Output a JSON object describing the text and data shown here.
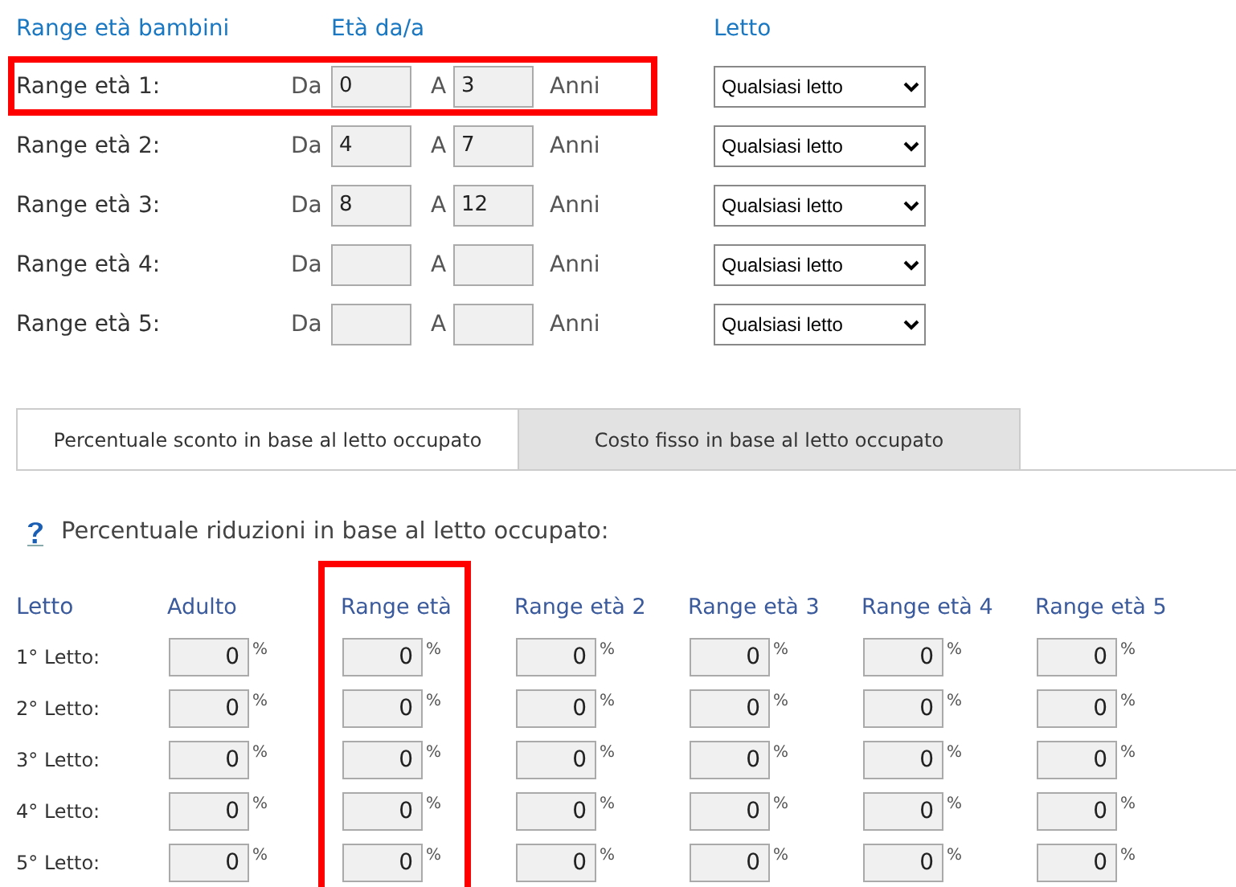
{
  "range_header": {
    "label": "Range età bambini",
    "ages": "Età da/a",
    "bed": "Letto"
  },
  "range_rows": [
    {
      "label": "Range età 1:",
      "from_label": "Da",
      "from": "0",
      "to_label": "A",
      "to": "3",
      "unit": "Anni",
      "bed": "Qualsiasi letto",
      "highlighted": true
    },
    {
      "label": "Range età 2:",
      "from_label": "Da",
      "from": "4",
      "to_label": "A",
      "to": "7",
      "unit": "Anni",
      "bed": "Qualsiasi letto",
      "highlighted": false
    },
    {
      "label": "Range età 3:",
      "from_label": "Da",
      "from": "8",
      "to_label": "A",
      "to": "12",
      "unit": "Anni",
      "bed": "Qualsiasi letto",
      "highlighted": false
    },
    {
      "label": "Range età 4:",
      "from_label": "Da",
      "to_label": "A",
      "unit": "Anni",
      "bed": "Qualsiasi letto",
      "highlighted": false
    },
    {
      "label": "Range età 5:",
      "from_label": "Da",
      "to_label": "A",
      "unit": "Anni",
      "bed": "Qualsiasi letto",
      "highlighted": false
    }
  ],
  "tabs": [
    {
      "label": "Percentuale sconto in base al letto occupato",
      "selected": true
    },
    {
      "label": "Costo fisso in base al letto occupato",
      "selected": false
    }
  ],
  "section_title": "Percentuale riduzioni in base al letto occupato:",
  "reductions": {
    "label_header": "Letto",
    "row_labels": [
      "1° Letto:",
      "2° Letto:",
      "3° Letto:",
      "4° Letto:",
      "5° Letto:"
    ],
    "columns": [
      {
        "header": "Adulto",
        "highlighted": false,
        "cells": [
          {
            "value": "0",
            "unit": "%"
          },
          {
            "value": "0",
            "unit": "%"
          },
          {
            "value": "0",
            "unit": "%"
          },
          {
            "value": "0",
            "unit": "%"
          },
          {
            "value": "0",
            "unit": "%"
          }
        ]
      },
      {
        "header": "Range età",
        "highlighted": true,
        "cells": [
          {
            "value": "0",
            "unit": "%"
          },
          {
            "value": "0",
            "unit": "%"
          },
          {
            "value": "0",
            "unit": "%"
          },
          {
            "value": "0",
            "unit": "%"
          },
          {
            "value": "0",
            "unit": "%"
          }
        ]
      },
      {
        "header": "Range età 2",
        "highlighted": false,
        "cells": [
          {
            "value": "0",
            "unit": "%"
          },
          {
            "value": "0",
            "unit": "%"
          },
          {
            "value": "0",
            "unit": "%"
          },
          {
            "value": "0",
            "unit": "%"
          },
          {
            "value": "0",
            "unit": "%"
          }
        ]
      },
      {
        "header": "Range età 3",
        "highlighted": false,
        "cells": [
          {
            "value": "0",
            "unit": "%"
          },
          {
            "value": "0",
            "unit": "%"
          },
          {
            "value": "0",
            "unit": "%"
          },
          {
            "value": "0",
            "unit": "%"
          },
          {
            "value": "0",
            "unit": "%"
          }
        ]
      },
      {
        "header": "Range età 4",
        "highlighted": false,
        "cells": [
          {
            "value": "0",
            "unit": "%"
          },
          {
            "value": "0",
            "unit": "%"
          },
          {
            "value": "0",
            "unit": "%"
          },
          {
            "value": "0",
            "unit": "%"
          },
          {
            "value": "0",
            "unit": "%"
          }
        ]
      },
      {
        "header": "Range età 5",
        "highlighted": false,
        "cells": [
          {
            "value": "0",
            "unit": "%"
          },
          {
            "value": "0",
            "unit": "%"
          },
          {
            "value": "0",
            "unit": "%"
          },
          {
            "value": "0",
            "unit": "%"
          },
          {
            "value": "0",
            "unit": "%"
          }
        ]
      }
    ]
  }
}
